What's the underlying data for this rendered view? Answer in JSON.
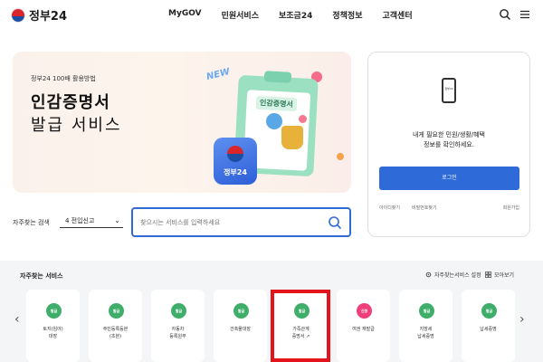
{
  "header": {
    "logo_text": "정부24",
    "nav": [
      "MyGOV",
      "민원서비스",
      "보조금24",
      "정책정보",
      "고객센터"
    ],
    "icons": [
      "search-icon",
      "menu-icon"
    ]
  },
  "banner": {
    "subtitle": "정부24 100배 활용방법",
    "title_line1": "인감증명서",
    "title_line2": "발급 서비스",
    "new_label": "NEW",
    "clipboard_label": "인감증명서",
    "app_label": "정부24"
  },
  "search": {
    "freq_label": "자주찾는 검색",
    "freq_selected": "4 전입신고",
    "placeholder": "찾으시는 서비스를 입력하세요"
  },
  "login": {
    "phone_label": "정부24",
    "message_line1": "내게 필요한 민원/생활/혜택",
    "message_line2": "정보를 확인하세요.",
    "button": "로그인",
    "links": [
      "아이디찾기",
      "비밀번호찾기",
      "회원가입"
    ]
  },
  "services": {
    "title": "자주찾는 서비스",
    "setting_label": "자주찾는서비스 설정",
    "more_label": "모아보기",
    "items": [
      {
        "badge": "발급",
        "name1": "토지(임야)",
        "name2": "대장",
        "color": "#3fae6a"
      },
      {
        "badge": "발급",
        "name1": "주민등록등본",
        "name2": "(초본)",
        "color": "#3fae6a"
      },
      {
        "badge": "발급",
        "name1": "자동차",
        "name2": "등록원부",
        "color": "#3fae6a"
      },
      {
        "badge": "발급",
        "name1": "건축물대장",
        "name2": "",
        "color": "#3fae6a"
      },
      {
        "badge": "발급",
        "name1": "가족관계",
        "name2": "증명서 ↗",
        "color": "#3fae6a"
      },
      {
        "badge": "신청",
        "name1": "여권 재발급",
        "name2": "",
        "color": "#ee3f7a"
      },
      {
        "badge": "발급",
        "name1": "지방세",
        "name2": "납세증명",
        "color": "#3fae6a"
      },
      {
        "badge": "발급",
        "name1": "납세증명",
        "name2": "",
        "color": "#3fae6a"
      }
    ]
  },
  "colors": {
    "accent": "#2e6bd9",
    "highlight": "#e3141b",
    "badge_green": "#3fae6a",
    "badge_pink": "#ee3f7a"
  }
}
